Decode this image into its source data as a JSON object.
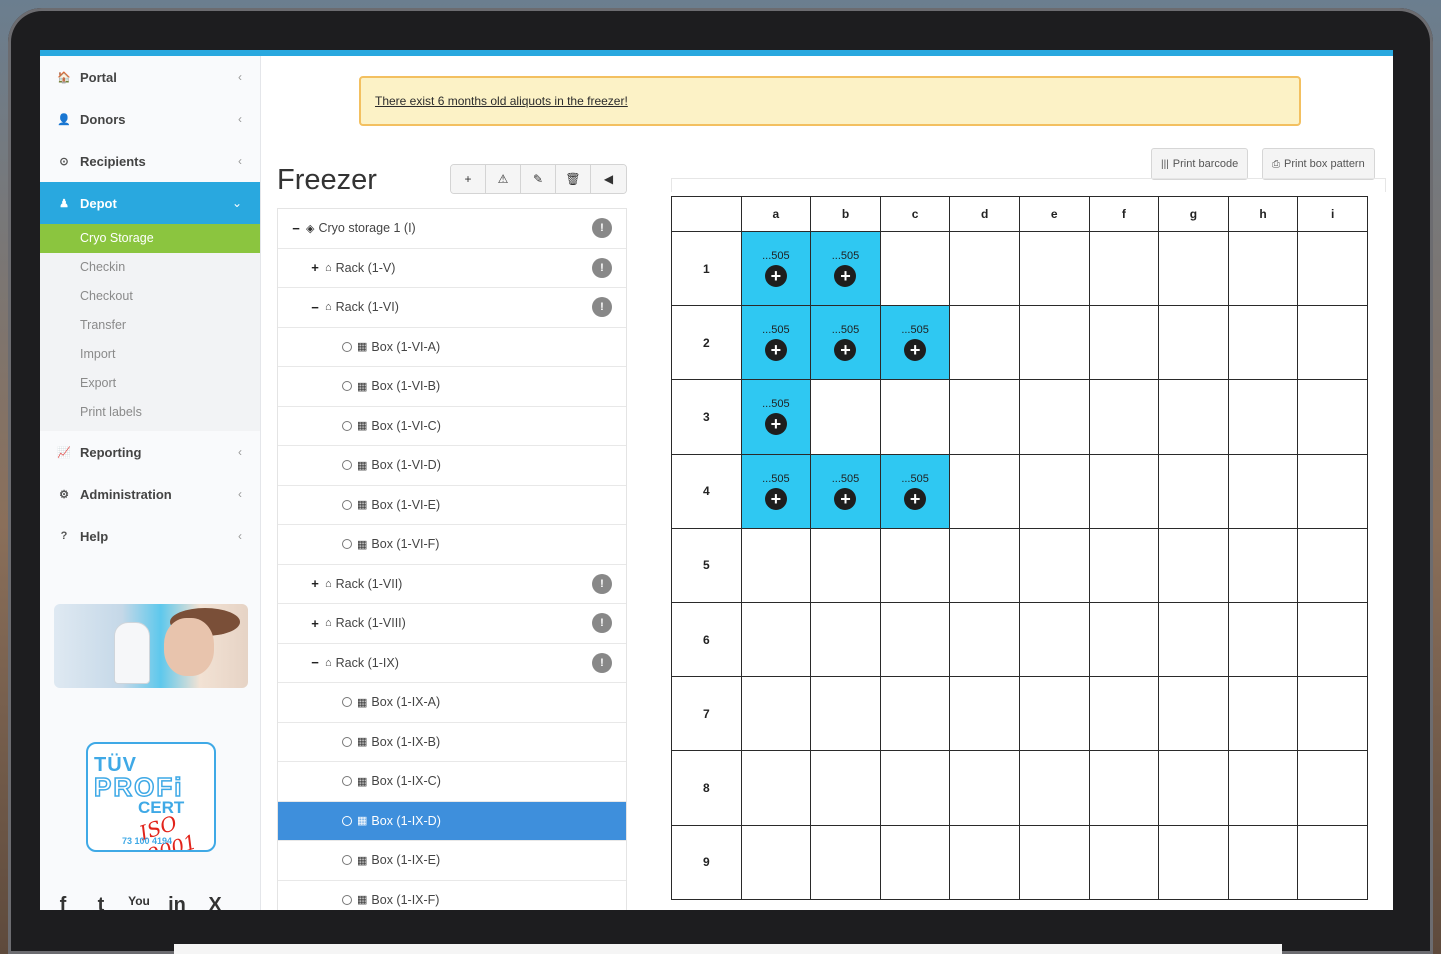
{
  "sidebar": {
    "items": [
      {
        "icon": "home-icon",
        "glyph": "🏠",
        "label": "Portal",
        "chevron": "‹"
      },
      {
        "icon": "user-icon",
        "glyph": "👤",
        "label": "Donors",
        "chevron": "‹"
      },
      {
        "icon": "recipient-icon",
        "glyph": "⊙",
        "label": "Recipients",
        "chevron": "‹"
      },
      {
        "icon": "depot-icon",
        "glyph": "♟",
        "label": "Depot",
        "chevron": "⌄"
      }
    ],
    "depot_sub": [
      "Cryo Storage",
      "Checkin",
      "Checkout",
      "Transfer",
      "Import",
      "Export",
      "Print labels"
    ],
    "items_after": [
      {
        "icon": "chart-icon",
        "glyph": "📈",
        "label": "Reporting",
        "chevron": "‹"
      },
      {
        "icon": "gear-icon",
        "glyph": "⚙",
        "label": "Administration",
        "chevron": "‹"
      },
      {
        "icon": "help-icon",
        "glyph": "?",
        "label": "Help",
        "chevron": "‹"
      }
    ],
    "cert": {
      "line1": "TÜV",
      "line2": "PROFi",
      "line3": "CERT",
      "line4": "ISO 9001",
      "line5": "73 100 4194"
    },
    "social": [
      "f",
      "t",
      "You",
      "in",
      "X"
    ]
  },
  "alert": {
    "text": "There exist 6 months old aliquots in the freezer!"
  },
  "freezer": {
    "title": "Freezer",
    "toolbar": [
      "+",
      "⚠",
      "✎",
      "🗑",
      "◀"
    ],
    "tree": [
      {
        "level": 0,
        "toggle": "−",
        "type": "storage",
        "label": "Cryo storage 1 (I)",
        "badge": "!"
      },
      {
        "level": 1,
        "toggle": "+",
        "type": "rack",
        "label": "Rack (1-V)",
        "badge": "!"
      },
      {
        "level": 1,
        "toggle": "−",
        "type": "rack",
        "label": "Rack (1-VI)",
        "badge": "!"
      },
      {
        "level": 2,
        "type": "box",
        "label": "Box (1-VI-A)"
      },
      {
        "level": 2,
        "type": "box",
        "label": "Box (1-VI-B)"
      },
      {
        "level": 2,
        "type": "box",
        "label": "Box (1-VI-C)"
      },
      {
        "level": 2,
        "type": "box",
        "label": "Box (1-VI-D)"
      },
      {
        "level": 2,
        "type": "box",
        "label": "Box (1-VI-E)"
      },
      {
        "level": 2,
        "type": "box",
        "label": "Box (1-VI-F)"
      },
      {
        "level": 1,
        "toggle": "+",
        "type": "rack",
        "label": "Rack (1-VII)",
        "badge": "!"
      },
      {
        "level": 1,
        "toggle": "+",
        "type": "rack",
        "label": "Rack (1-VIII)",
        "badge": "!"
      },
      {
        "level": 1,
        "toggle": "−",
        "type": "rack",
        "label": "Rack (1-IX)",
        "badge": "!"
      },
      {
        "level": 2,
        "type": "box",
        "label": "Box (1-IX-A)"
      },
      {
        "level": 2,
        "type": "box",
        "label": "Box (1-IX-B)"
      },
      {
        "level": 2,
        "type": "box",
        "label": "Box (1-IX-C)"
      },
      {
        "level": 2,
        "type": "box",
        "label": "Box (1-IX-D)",
        "selected": true
      },
      {
        "level": 2,
        "type": "box",
        "label": "Box (1-IX-E)"
      },
      {
        "level": 2,
        "type": "box",
        "label": "Box (1-IX-F)"
      }
    ]
  },
  "actions": {
    "print_barcode": "Print barcode",
    "print_box_pattern": "Print box pattern"
  },
  "box_grid": {
    "columns": [
      "a",
      "b",
      "c",
      "d",
      "e",
      "f",
      "g",
      "h",
      "i"
    ],
    "rows": [
      "1",
      "2",
      "3",
      "4",
      "5",
      "6",
      "7",
      "8",
      "9"
    ],
    "cell_label": "...505",
    "filled": {
      "1": [
        "a",
        "b"
      ],
      "2": [
        "a",
        "b",
        "c"
      ],
      "3": [
        "a"
      ],
      "4": [
        "a",
        "b",
        "c"
      ]
    },
    "fill_color": "#2fc8f2"
  },
  "colors": {
    "accent": "#29a8df",
    "active_sub": "#8bc53f",
    "selected_row": "#3e8fdc",
    "alert_bg": "#fcf2c6"
  }
}
